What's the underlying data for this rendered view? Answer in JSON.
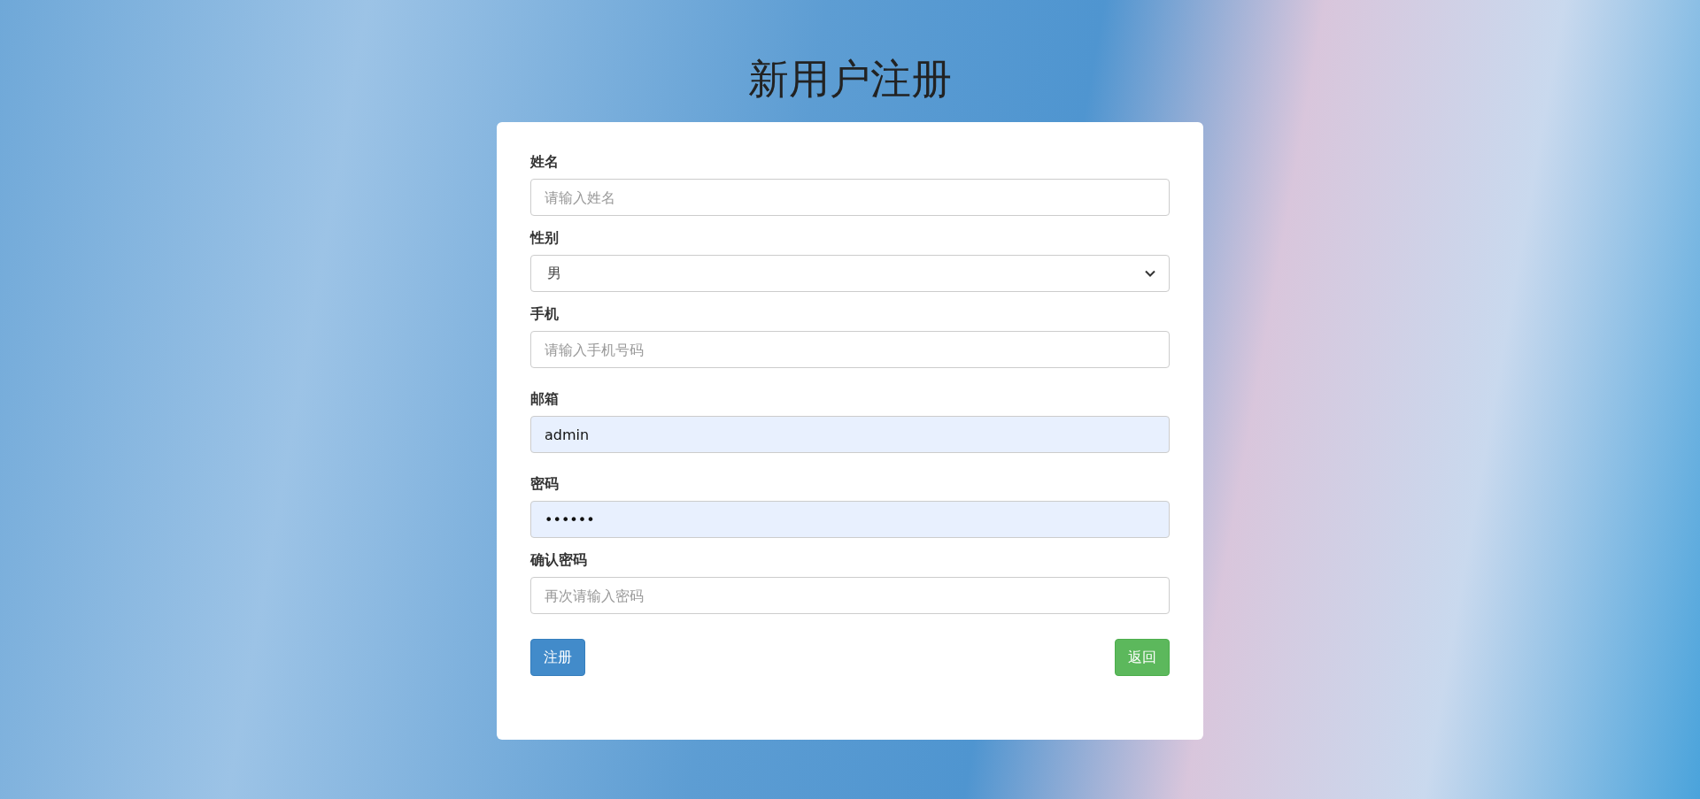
{
  "title": "新用户注册",
  "fields": [
    {
      "kind": "text",
      "label": "姓名",
      "placeholder": "请输入姓名",
      "autofilled": false
    },
    {
      "kind": "select",
      "label": "性别",
      "value": "男",
      "autofilled": false
    },
    {
      "kind": "text",
      "label": "手机",
      "placeholder": "请输入手机号码",
      "autofilled": false
    },
    {
      "kind": "text",
      "label": "邮箱",
      "value": "admin",
      "autofilled": true
    },
    {
      "kind": "text",
      "label": "密码",
      "value": "••••••",
      "autofilled": true
    },
    {
      "kind": "text",
      "label": "确认密码",
      "placeholder": "再次请输入密码",
      "autofilled": false
    }
  ],
  "buttons": [
    {
      "kind": "primary",
      "label": "注册"
    },
    {
      "kind": "success",
      "label": "返回"
    }
  ]
}
